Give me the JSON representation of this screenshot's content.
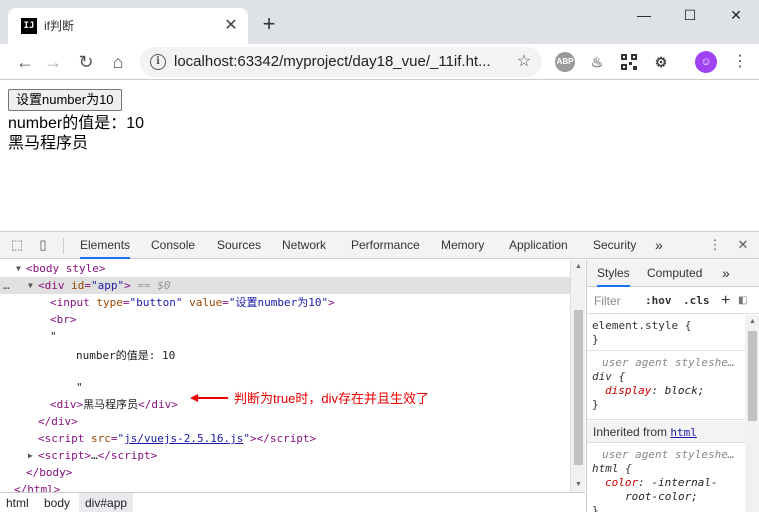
{
  "tab": {
    "title": "if判断",
    "favicon": "IJ"
  },
  "window": {
    "minimize": "—",
    "maximize": "☐",
    "close": "✕"
  },
  "toolbar": {
    "url": "localhost:63342/myproject/day18_vue/_11if.ht...",
    "extensions": [
      "ABP",
      "java",
      "qr",
      "crx"
    ]
  },
  "page": {
    "button_label": "设置number为10",
    "number_line": "number的值是：10",
    "text_line": "黑马程序员"
  },
  "devtools": {
    "tabs": [
      "Elements",
      "Console",
      "Sources",
      "Network",
      "Performance",
      "Memory",
      "Application",
      "Security"
    ],
    "more": "»",
    "elements": {
      "body_open": "<body style>",
      "div_app": "<div id=\"app\">",
      "eq_sel": "== $0",
      "input_line": "<input type=\"button\" value=\"设置number为10\">",
      "br": "<br>",
      "quote1": "\"",
      "number_text": "number的值是: 10",
      "quote2": "\"",
      "div_text": "黑马程序员",
      "div_close": "</div>",
      "script_src": "js/vuejs-2.5.16.js",
      "script_collapsed": "…",
      "body_close": "</body>",
      "html_close": "</html>"
    },
    "annotation": "判断为true时，div存在并且生效了",
    "breadcrumbs": [
      "html",
      "body",
      "div#app"
    ],
    "styles": {
      "tabs": [
        "Styles",
        "Computed"
      ],
      "filter": "Filter",
      "hov": ":hov",
      "cls": ".cls",
      "element_style": "element.style {",
      "close_brace": "}",
      "ua_label": "user agent styleshe…",
      "div_selector": "div {",
      "display_prop": "display",
      "display_val": "block;",
      "inherited_label": "Inherited from",
      "inherited_tag": "html",
      "html_selector": "html {",
      "color_prop": "color",
      "color_val": "-internal-",
      "color_val2": "root-color;"
    }
  },
  "colors": {
    "accent": "#1a73e8",
    "annotation": "#e00000",
    "avatar": "#a142f4"
  }
}
